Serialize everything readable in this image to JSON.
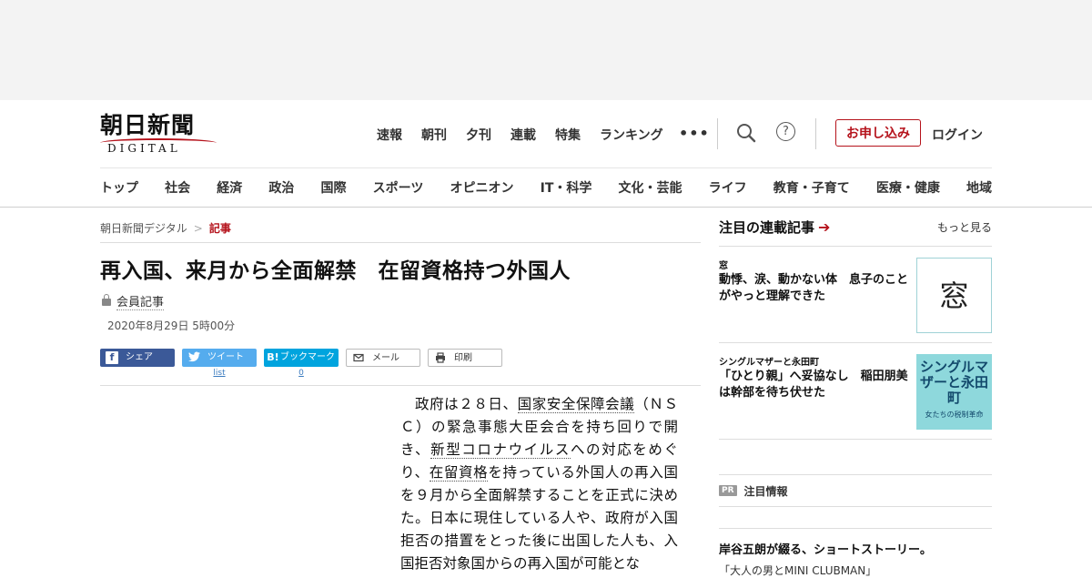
{
  "header": {
    "logo_kanji": "朝日新聞",
    "logo_latin": "DIGITAL",
    "nav": [
      "速報",
      "朝刊",
      "夕刊",
      "連載",
      "特集",
      "ランキング"
    ],
    "more": "•••",
    "help": "?",
    "apply_label": "お申し込み",
    "login_label": "ログイン"
  },
  "categories": [
    "トップ",
    "社会",
    "経済",
    "政治",
    "国際",
    "スポーツ",
    "オピニオン",
    "IT・科学",
    "文化・芸能",
    "ライフ",
    "教育・子育て",
    "医療・健康",
    "地域"
  ],
  "breadcrumb": {
    "home": "朝日新聞デジタル",
    "sep": ">",
    "current": "記事"
  },
  "article": {
    "title": "再入国、来月から全面解禁　在留資格持つ外国人",
    "member_label": "会員記事",
    "date": "2020年8月29日 5時00分",
    "share": {
      "facebook": "シェア",
      "twitter": "ツイート",
      "twitter_count": "list",
      "hatena_icon": "B!",
      "hatena": "ブックマーク",
      "hatena_count": "0",
      "mail": "メール",
      "print": "印刷"
    },
    "body": {
      "p1": "政府は２８日、",
      "kw1": "国家安全保障会議",
      "p2": "（ＮＳＣ）の緊急事態大臣会合を持ち回りで開き、",
      "kw2": "新型コロナウイルス",
      "p3": "への対応をめぐり、",
      "kw3": "在留資格",
      "p4": "を持っている外国人の再入国を９月から全面解禁することを正式に決めた。日本に現住している人や、政府が入国拒否の措置をとった後に出国した人も、入国拒否対象国からの再入国が可能とな"
    }
  },
  "sidebar": {
    "heading": "注目の連載記事",
    "arrow": "➔",
    "more": "もっと見る",
    "items": [
      {
        "category": "窓",
        "headline": "動悸、涙、動かない体　息子のことがやっと理解できた",
        "thumb_text": "窓"
      },
      {
        "category": "シングルマザーと永田町",
        "headline": "「ひとり親」へ妥協なし　稲田朋美は幹部を待ち伏せた",
        "thumb_big": "シングルマザーと永田町",
        "thumb_small": "女たちの税制革命"
      }
    ],
    "pr_badge": "PR",
    "pr_label": "注目情報",
    "pr_item_title": "岸谷五朗が綴る、ショートストーリー。",
    "pr_item_sub": "「大人の男とMINI CLUBMAN」"
  },
  "colors": {
    "accent": "#b5121b",
    "facebook": "#3b5998",
    "twitter": "#55acee",
    "hatena": "#00a4de"
  },
  "icons": {
    "search": "search-icon",
    "help": "help-icon",
    "lock": "lock-icon",
    "mail": "mail-icon",
    "print": "print-icon"
  }
}
